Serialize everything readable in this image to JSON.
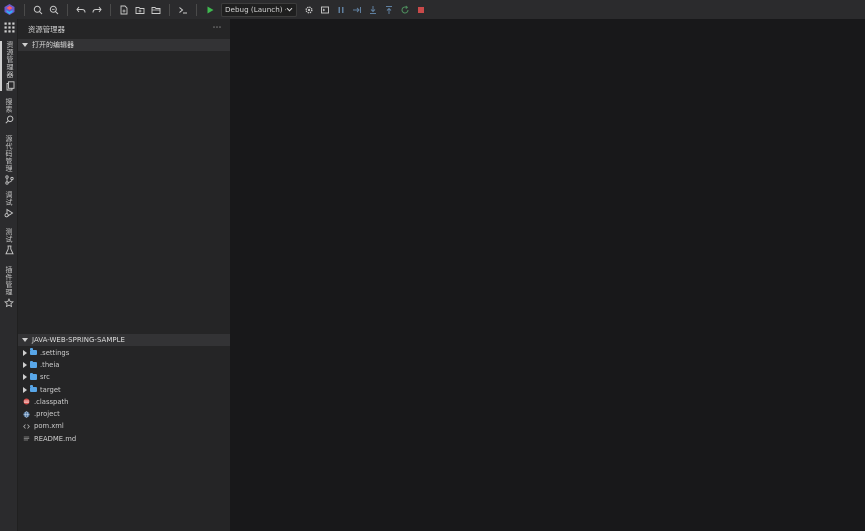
{
  "toolbar": {
    "debug_config": "Debug (Launch) - Cr",
    "colors": {
      "run": "#3fb950",
      "stop": "#e5534b",
      "debug_disabled": "#5f7f9f"
    }
  },
  "activity_bar": {
    "items": [
      {
        "label": "资源管理器",
        "icon": "files-icon"
      },
      {
        "label": "搜索",
        "icon": "search-icon"
      },
      {
        "label": "源代码管理",
        "icon": "source-control-icon"
      },
      {
        "label": "调试",
        "icon": "debug-icon"
      },
      {
        "label": "测试",
        "icon": "beaker-icon"
      },
      {
        "label": "插件管理",
        "icon": "extensions-icon"
      }
    ]
  },
  "sidebar": {
    "title": "资源管理器",
    "open_editors": "打开的编辑器",
    "project": "JAVA-WEB-SPRING-SAMPLE",
    "tree": [
      {
        "name": ".settings",
        "type": "folder"
      },
      {
        "name": ".theia",
        "type": "folder"
      },
      {
        "name": "src",
        "type": "folder"
      },
      {
        "name": "target",
        "type": "folder"
      },
      {
        "name": ".classpath",
        "type": "file",
        "icon": "eclipse-icon"
      },
      {
        "name": ".project",
        "type": "file",
        "icon": "globe-icon"
      },
      {
        "name": "pom.xml",
        "type": "file",
        "icon": "xml-icon"
      },
      {
        "name": "README.md",
        "type": "file",
        "icon": "markdown-icon"
      }
    ]
  }
}
